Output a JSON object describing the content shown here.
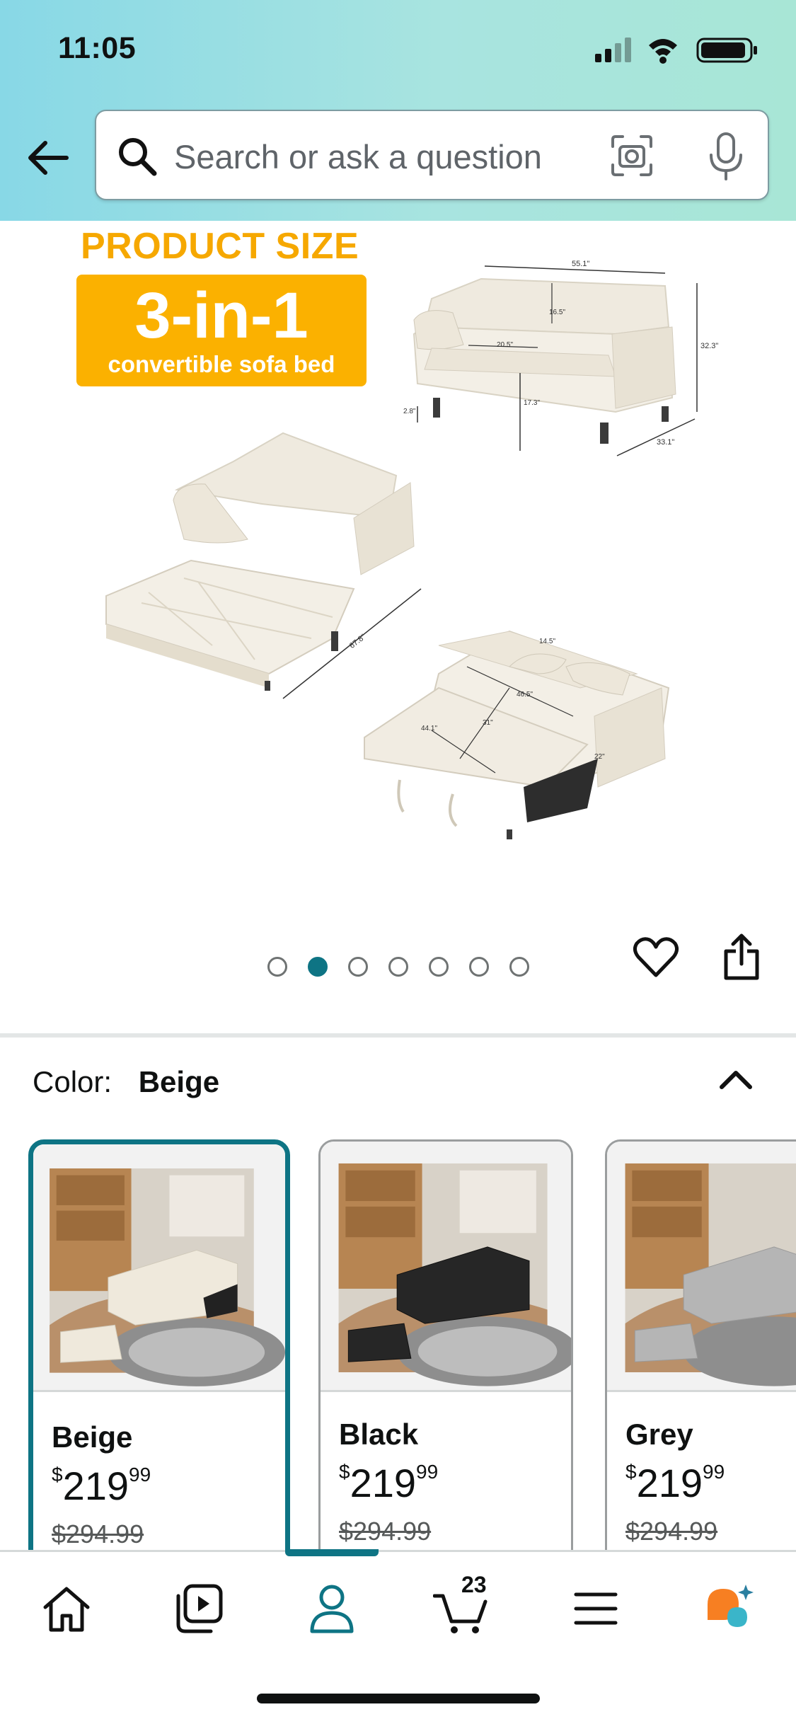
{
  "status_bar": {
    "time": "11:05"
  },
  "search": {
    "placeholder": "Search or ask a question"
  },
  "gallery": {
    "heading": "PRODUCT SIZE",
    "badge_main": "3-in-1",
    "badge_sub": "convertible sofa bed",
    "dimensions": [
      "55.1\"",
      "16.5\"",
      "20.5\"",
      "32.3\"",
      "17.3\"",
      "2.8\"",
      "33.1\"",
      "67.8\"",
      "14.5\"",
      "46.5\"",
      "44.1\"",
      "31\"",
      "22\""
    ],
    "image_count": 7,
    "active_index": 1
  },
  "color": {
    "label": "Color:",
    "value": "Beige",
    "options": [
      {
        "name": "Beige",
        "currency": "$",
        "price_whole": "219",
        "price_fraction": "99",
        "list_price": "$294.99",
        "selected": true
      },
      {
        "name": "Black",
        "currency": "$",
        "price_whole": "219",
        "price_fraction": "99",
        "list_price": "$294.99",
        "selected": false
      },
      {
        "name": "Grey",
        "currency": "$",
        "price_whole": "219",
        "price_fraction": "99",
        "list_price": "$294.99",
        "selected": false
      }
    ]
  },
  "bottom_nav": {
    "items": [
      "home-icon",
      "video-library-icon",
      "account-icon",
      "cart-icon",
      "menu-icon",
      "rufus-assistant-icon"
    ],
    "active": "account-icon",
    "cart_count": "23"
  },
  "colors": {
    "accent": "#0e7484",
    "badge": "#fbb100",
    "rufus_orange": "#f77f22",
    "rufus_teal": "#3ab5c9"
  }
}
